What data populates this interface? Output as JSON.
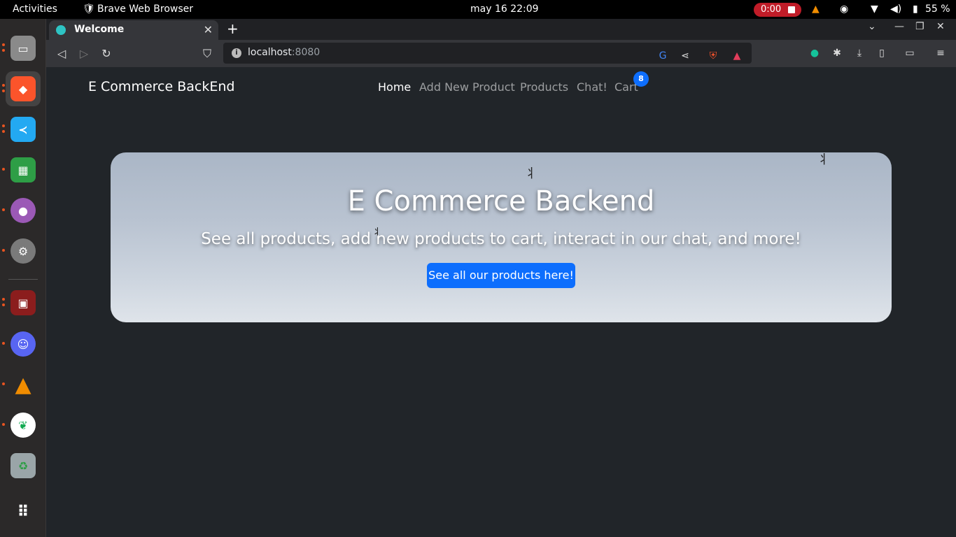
{
  "topbar": {
    "activities": "Activities",
    "app_name": "Brave Web Browser",
    "datetime": "may 16  22:09",
    "recording_time": "0:00",
    "battery": "55 %"
  },
  "dock": {
    "items": [
      {
        "name": "files",
        "color": "#8a8a8a"
      },
      {
        "name": "brave",
        "color": "#fb542b"
      },
      {
        "name": "vscode",
        "color": "#23a9f2"
      },
      {
        "name": "spreadsheet",
        "color": "#2e9e46"
      },
      {
        "name": "github",
        "color": "#9b59b6"
      },
      {
        "name": "settings",
        "color": "#7a7a7a"
      },
      {
        "name": "terminal",
        "color": "#8b1d1d"
      },
      {
        "name": "discord",
        "color": "#5865f2"
      },
      {
        "name": "vlc",
        "color": "#f08c00"
      },
      {
        "name": "mongodb",
        "color": "#ffffff"
      },
      {
        "name": "trash",
        "color": "#9aa5a8"
      }
    ]
  },
  "browser": {
    "tab_title": "Welcome",
    "url_host": "localhost",
    "url_port": ":8080"
  },
  "page": {
    "brand": "E Commerce BackEnd",
    "nav": {
      "home": "Home",
      "add_product": "Add New Product",
      "products": "Products",
      "chat": "Chat!",
      "cart": "Cart",
      "cart_count": "8"
    },
    "hero": {
      "title": "E Commerce Backend",
      "subtitle": "See all products, add new products to cart, interact in our chat, and more!",
      "button": "See all our products here!"
    }
  },
  "colors": {
    "accent": "#0d6efd",
    "page_bg": "#212529"
  }
}
